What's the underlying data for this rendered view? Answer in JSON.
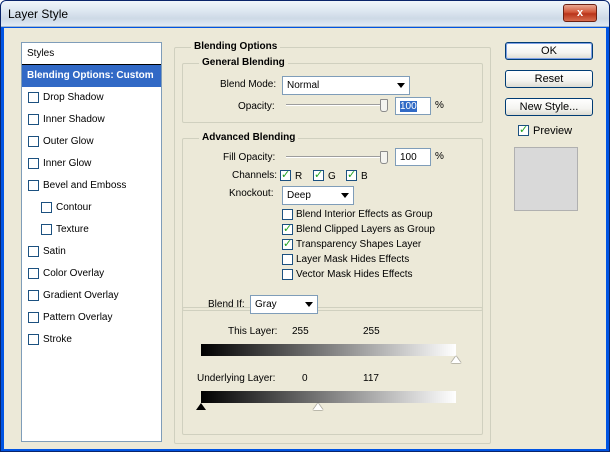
{
  "window": {
    "title": "Layer Style",
    "close_glyph": "x"
  },
  "styles_list": {
    "header": "Styles",
    "items": [
      {
        "label": "Blending Options: Custom",
        "selected": true,
        "has_checkbox": false
      },
      {
        "label": "Drop Shadow"
      },
      {
        "label": "Inner Shadow"
      },
      {
        "label": "Outer Glow"
      },
      {
        "label": "Inner Glow"
      },
      {
        "label": "Bevel and Emboss"
      },
      {
        "label": "Contour"
      },
      {
        "label": "Texture"
      },
      {
        "label": "Satin"
      },
      {
        "label": "Color Overlay"
      },
      {
        "label": "Gradient Overlay"
      },
      {
        "label": "Pattern Overlay"
      },
      {
        "label": "Stroke"
      }
    ]
  },
  "blending_options": {
    "title": "Blending Options",
    "general": {
      "title": "General Blending",
      "blend_mode_label": "Blend Mode:",
      "blend_mode_value": "Normal",
      "opacity_label": "Opacity:",
      "opacity_value": "100",
      "opacity_unit": "%",
      "opacity_level": 1.0
    },
    "advanced": {
      "title": "Advanced Blending",
      "fill_opacity_label": "Fill Opacity:",
      "fill_opacity_value": "100",
      "fill_opacity_unit": "%",
      "fill_opacity_level": 1.0,
      "channels_label": "Channels:",
      "channels": [
        {
          "label": "R",
          "checked": true
        },
        {
          "label": "G",
          "checked": true
        },
        {
          "label": "B",
          "checked": true
        }
      ],
      "knockout_label": "Knockout:",
      "knockout_value": "Deep",
      "options": [
        {
          "label": "Blend Interior Effects as Group",
          "checked": false
        },
        {
          "label": "Blend Clipped Layers as Group",
          "checked": true
        },
        {
          "label": "Transparency Shapes Layer",
          "checked": true
        },
        {
          "label": "Layer Mask Hides Effects",
          "checked": false
        },
        {
          "label": "Vector Mask Hides Effects",
          "checked": false
        }
      ]
    },
    "blend_if": {
      "label": "Blend If:",
      "value": "Gray",
      "this_layer_label": "This Layer:",
      "this_layer_low": "255",
      "this_layer_high": "255",
      "underlying_label": "Underlying Layer:",
      "underlying_low": "0",
      "underlying_high": "117"
    }
  },
  "buttons": {
    "ok": "OK",
    "reset": "Reset",
    "new_style": "New Style...",
    "preview_label": "Preview",
    "preview_checked": true
  },
  "colors": {
    "selection": "#3169c6",
    "title_bar": "#dde7f1",
    "face": "#ece9d8"
  }
}
